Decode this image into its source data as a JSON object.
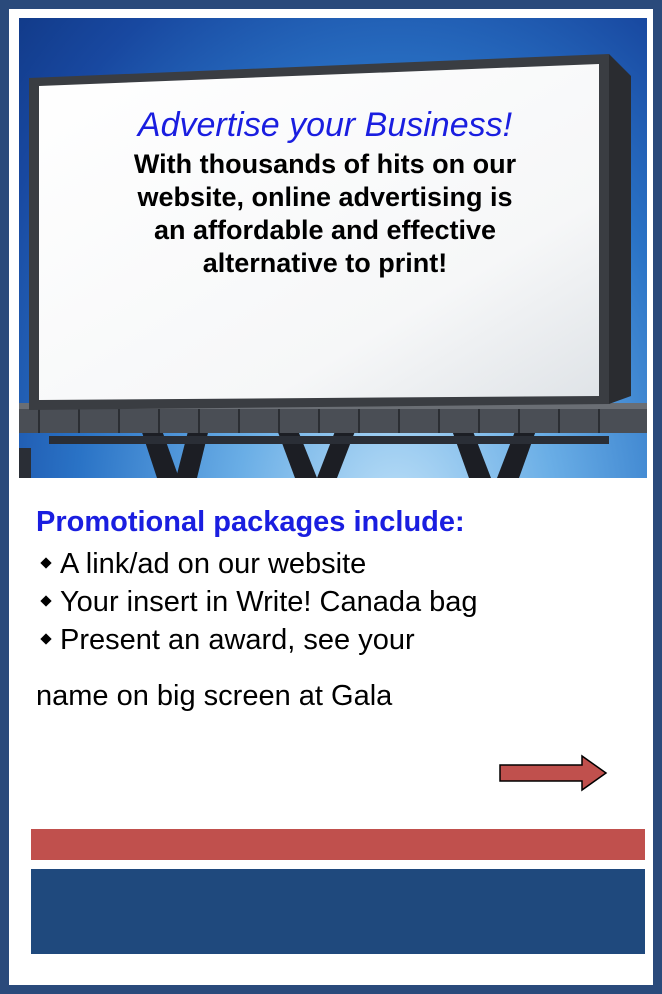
{
  "billboard": {
    "title": "Advertise your Business!",
    "lines": [
      "With thousands of hits on our",
      "website, online advertising is",
      "an affordable and effective",
      "alternative to print!"
    ]
  },
  "promo": {
    "heading": "Promotional packages include:",
    "items": [
      "A link/ad on our website",
      "Your insert in Write! Canada bag",
      "Present an award, see your"
    ],
    "continuation": "name on big screen at Gala"
  },
  "colors": {
    "frame": "#2a4a7b",
    "accent_blue_text": "#1a1ee0",
    "arrow": "#c0504d",
    "red_bar": "#c0504d",
    "blue_bar": "#1f497d"
  },
  "icons": {
    "next": "right-arrow-icon",
    "bullet": "diamond-bullet-icon"
  }
}
